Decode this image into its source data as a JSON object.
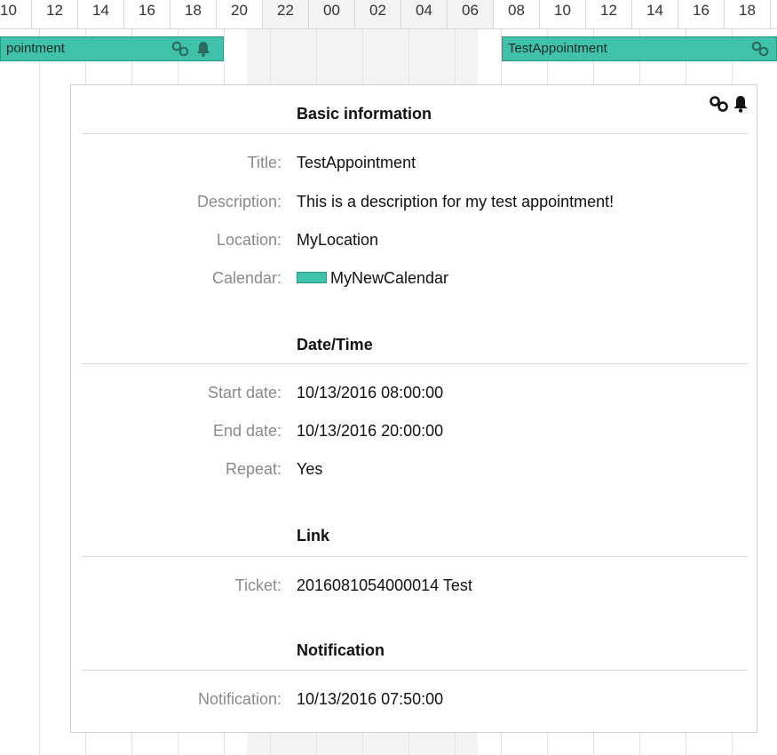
{
  "timeline": {
    "hours": [
      "10",
      "12",
      "14",
      "16",
      "18",
      "20",
      "22",
      "00",
      "02",
      "04",
      "06",
      "08",
      "10",
      "12",
      "14",
      "16",
      "18"
    ]
  },
  "appointments": [
    {
      "label": "pointment"
    },
    {
      "label": "TestAppointment"
    }
  ],
  "colors": {
    "calendar": "#3fc1aa",
    "calendar_border": "#249b86"
  },
  "tooltip": {
    "icons": [
      "link-icon",
      "bell-icon"
    ],
    "basic": {
      "heading": "Basic information",
      "title_label": "Title:",
      "title_value": "TestAppointment",
      "description_label": "Description:",
      "description_value": "This is a description for my test appointment!",
      "location_label": "Location:",
      "location_value": "MyLocation",
      "calendar_label": "Calendar:",
      "calendar_value": "MyNewCalendar"
    },
    "datetime": {
      "heading": "Date/Time",
      "start_label": "Start date:",
      "start_value": "10/13/2016 08:00:00",
      "end_label": "End date:",
      "end_value": "10/13/2016 20:00:00",
      "repeat_label": "Repeat:",
      "repeat_value": "Yes"
    },
    "link": {
      "heading": "Link",
      "ticket_label": "Ticket:",
      "ticket_value": "2016081054000014 Test"
    },
    "notification": {
      "heading": "Notification",
      "notification_label": "Notification:",
      "notification_value": "10/13/2016 07:50:00"
    }
  }
}
